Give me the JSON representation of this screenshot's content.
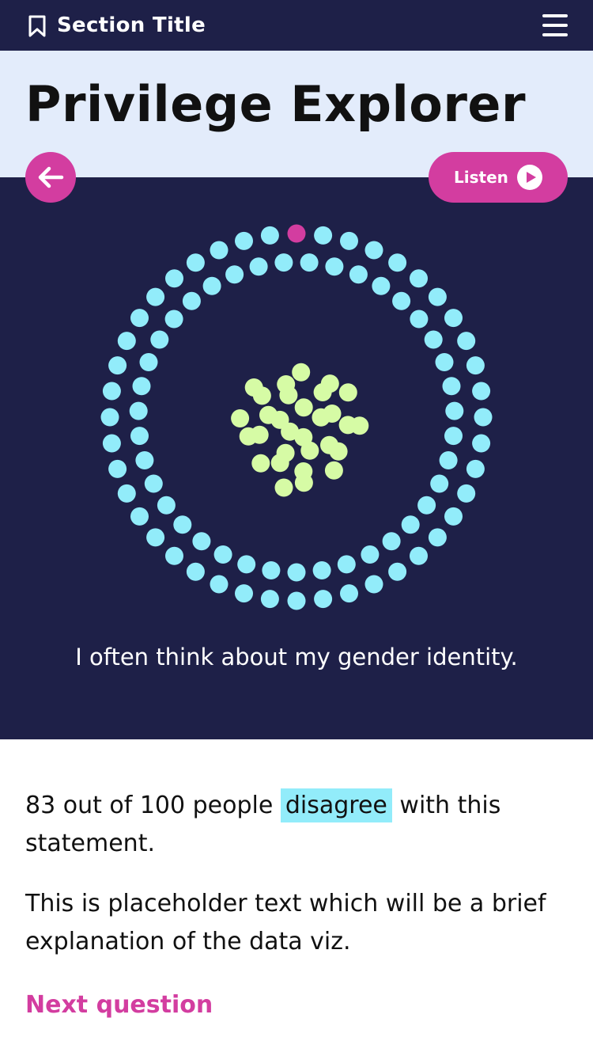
{
  "header": {
    "section_title": "Section Title",
    "icons": {
      "bookmark": "bookmark-icon",
      "menu": "hamburger-menu-icon"
    }
  },
  "page": {
    "title": "Privilege Explorer"
  },
  "controls": {
    "back_icon": "arrow-left-icon",
    "listen_label": "Listen",
    "listen_icon": "play-icon"
  },
  "viz": {
    "statement": "I often think about my gender identity.",
    "total_people": 100,
    "disagree_count": 83,
    "agree_count": 17,
    "highlighted_index": 0,
    "colors": {
      "disagree": "#92ecfa",
      "agree": "#d6fba5",
      "highlight": "#d33da0",
      "panel_background": "#1e2048"
    }
  },
  "result": {
    "prefix": "83 out of 100 people ",
    "highlight_word": "disagree",
    "suffix": " with this statement."
  },
  "explanation": "This is placeholder text which will be a brief explanation of the data viz.",
  "next_label": "Next question",
  "colors": {
    "brand_dark": "#1e2048",
    "accent": "#d33da0",
    "title_band": "#e3ecfb"
  }
}
